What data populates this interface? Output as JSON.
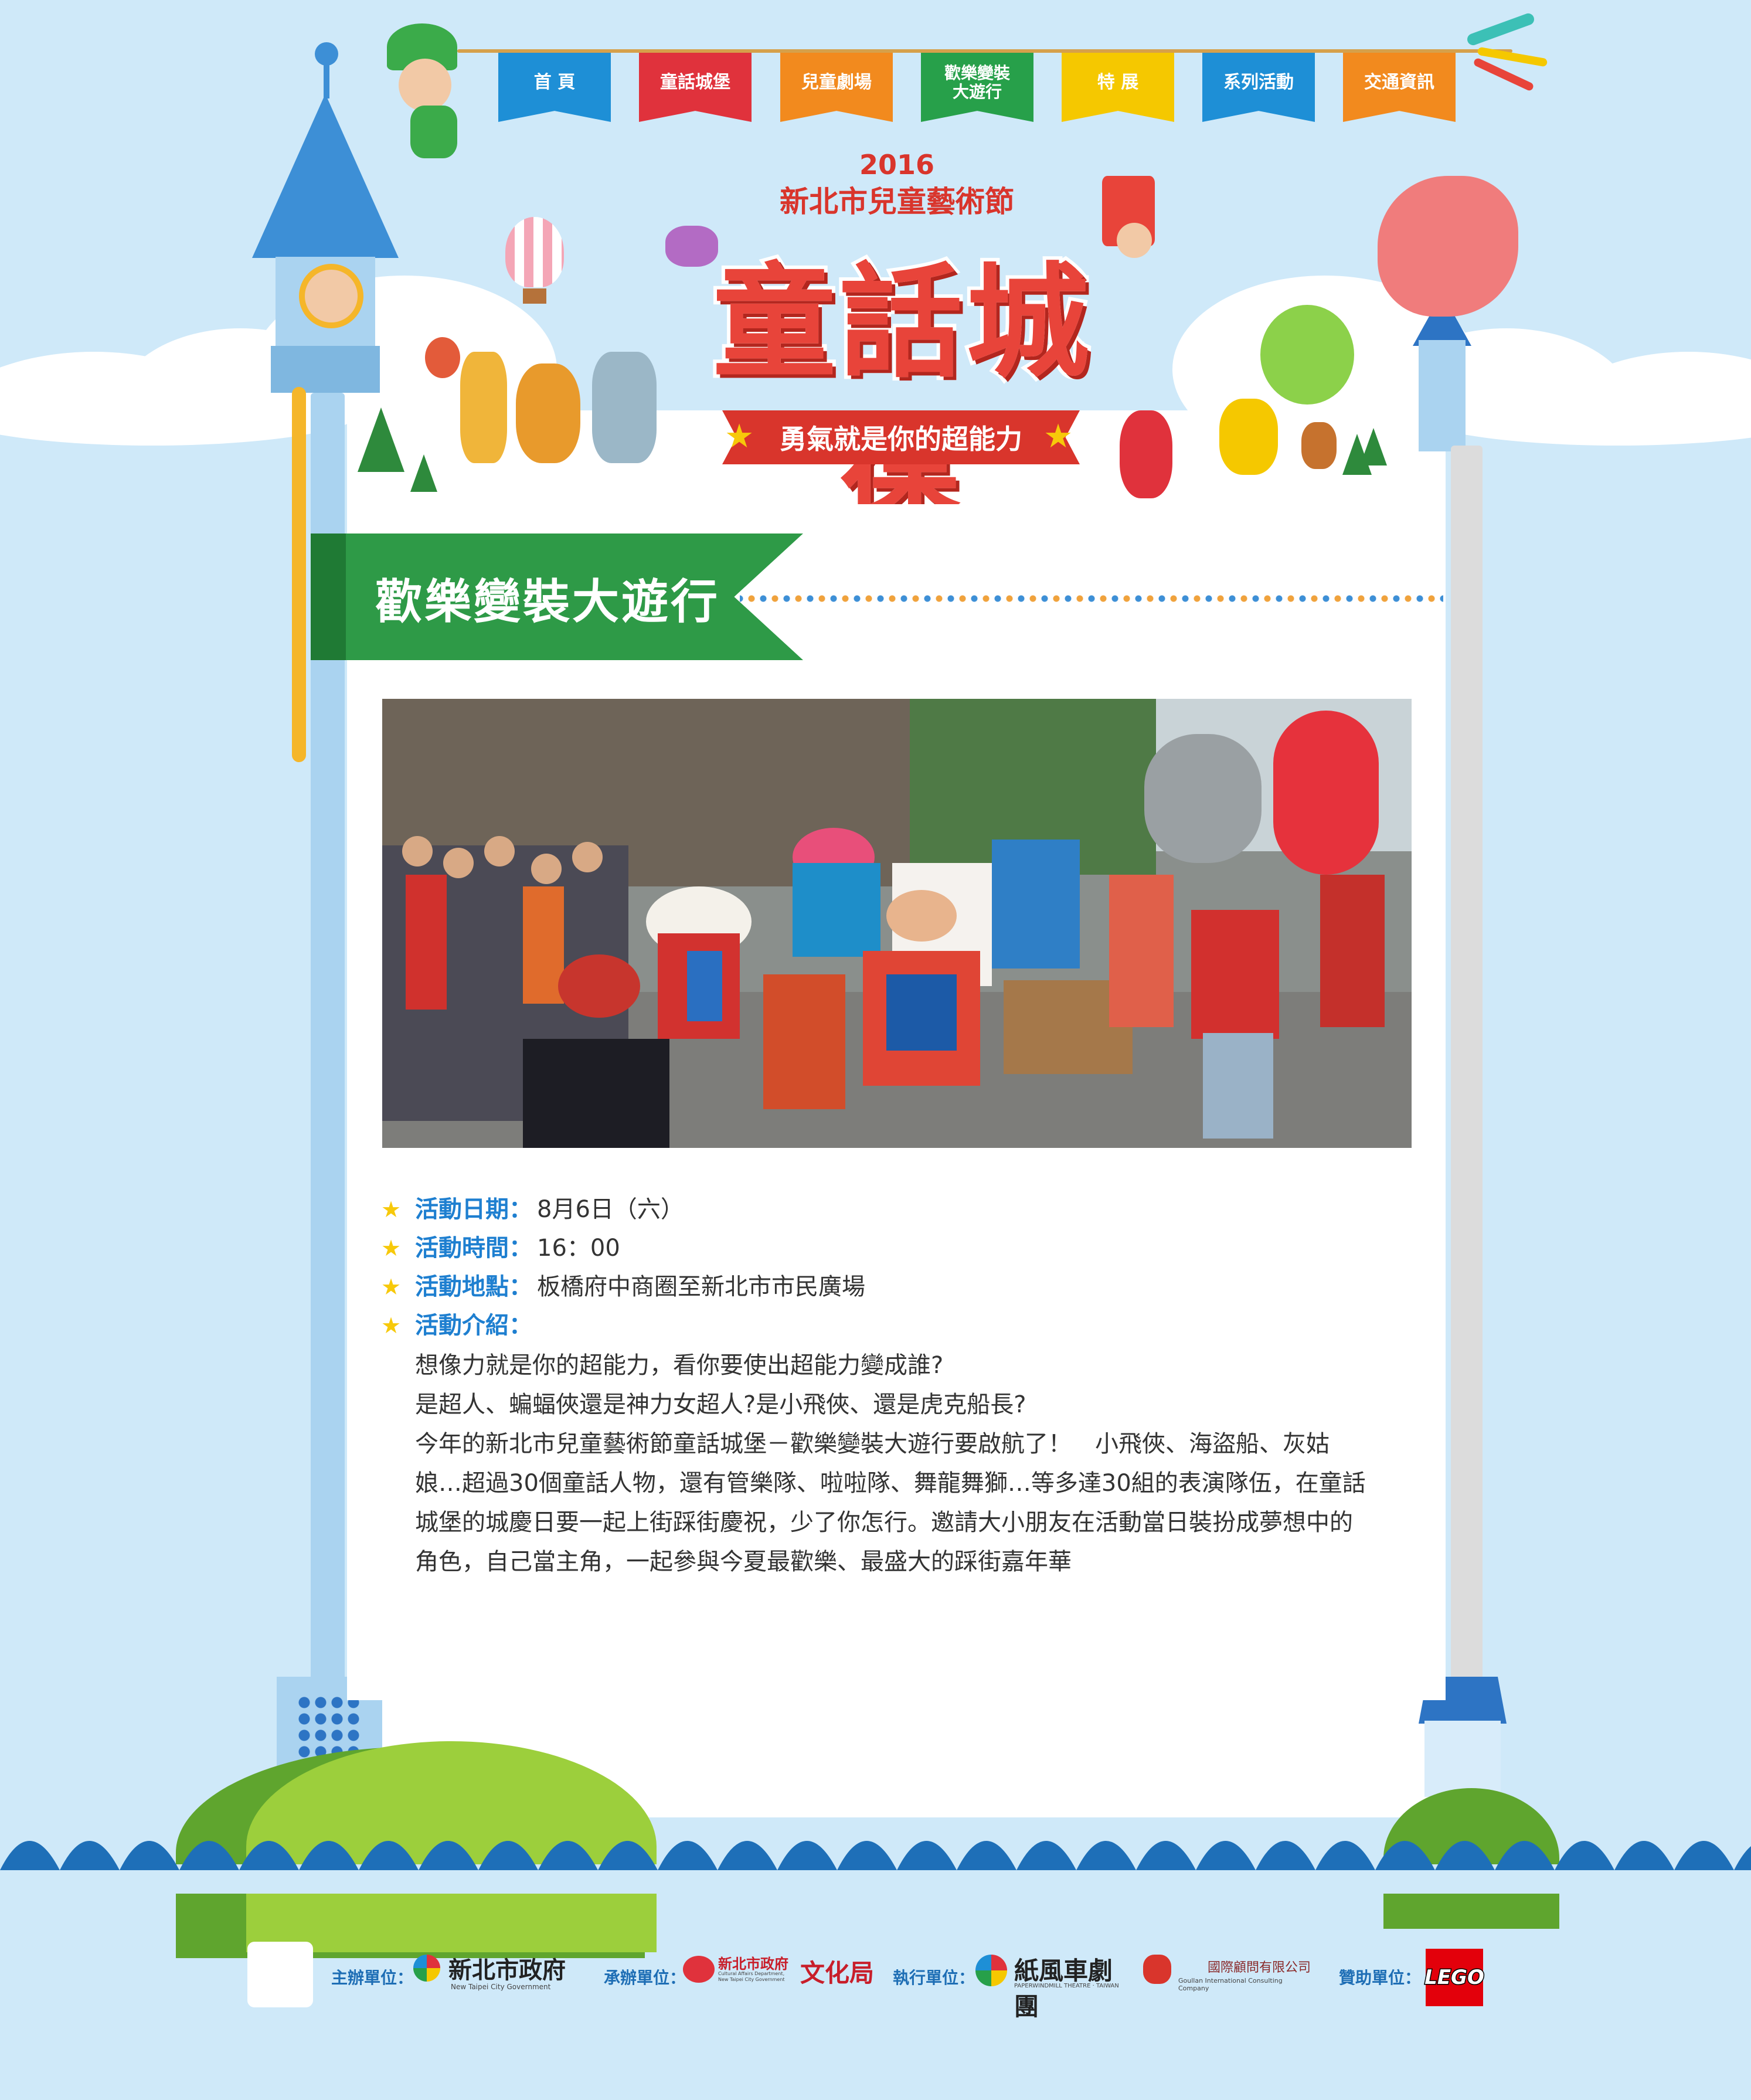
{
  "nav": {
    "items": [
      {
        "label": "首 頁",
        "color": "#1e8fd6"
      },
      {
        "label": "童話城堡",
        "color": "#e0323c"
      },
      {
        "label": "兒童劇場",
        "color": "#f28a1e"
      },
      {
        "label": "歡樂變裝大遊行",
        "color": "#27a04a"
      },
      {
        "label": "特 展",
        "color": "#f5c800"
      },
      {
        "label": "系列活動",
        "color": "#1e8fd6"
      },
      {
        "label": "交通資訊",
        "color": "#f28a1e"
      }
    ]
  },
  "header": {
    "year": "2016",
    "festival": "新北市兒童藝術節",
    "title": "童話城堡",
    "slogan": "勇氣就是你的超能力"
  },
  "section": {
    "title": "歡樂變裝大遊行"
  },
  "photo": {
    "alt": "parade-photo"
  },
  "info": {
    "date_label": "活動日期：",
    "date_value": "8月6日（六）",
    "time_label": "活動時間：",
    "time_value": "16：00",
    "place_label": "活動地點：",
    "place_value": "板橋府中商圈至新北市市民廣場",
    "intro_label": "活動介紹：",
    "intro_lines": [
      "想像力就是你的超能力，看你要使出超能力變成誰?",
      "是超人、蝙蝠俠還是神力女超人?是小飛俠、還是虎克船長?",
      "今年的新北市兒童藝術節童話城堡－歡樂變裝大遊行要啟航了！　小飛俠、海盜船、灰姑",
      "娘…超過30個童話人物，還有管樂隊、啦啦隊、舞龍舞獅…等多達30組的表演隊伍，在童話",
      "城堡的城慶日要一起上街踩街慶祝，少了你怎行。邀請大小朋友在活動當日裝扮成夢想中的",
      "角色，自己當主角，一起參與今夏最歡樂、最盛大的踩街嘉年華"
    ]
  },
  "footer": {
    "organizer_label": "主辦單位：",
    "organizer_name": "新北市政府",
    "organizer_sub": "New Taipei City Government",
    "coorganizer_label": "承辦單位：",
    "coorganizer_name": "新北市政府",
    "coorganizer_dept": "文化局",
    "coorganizer_sub": "Cultural Affairs Department, New Taipei City Government",
    "executor_label": "執行單位：",
    "executor_name": "紙風車劇團",
    "executor_sub": "PAPERWINDMILL THEATRE · TAIWAN",
    "executor2_name": "國際顧問有限公司",
    "executor2_sub": "Goullan International Consulting Company",
    "sponsor_label": "贊助單位：",
    "sponsor_name": "LEGO"
  },
  "colors": {
    "sky": "#cfe9f9",
    "banner_green": "#2e9a47",
    "label_blue": "#1e7fd0",
    "star_yellow": "#f7c90a",
    "title_red": "#e8443a",
    "sea_blue": "#1e6fb8"
  }
}
